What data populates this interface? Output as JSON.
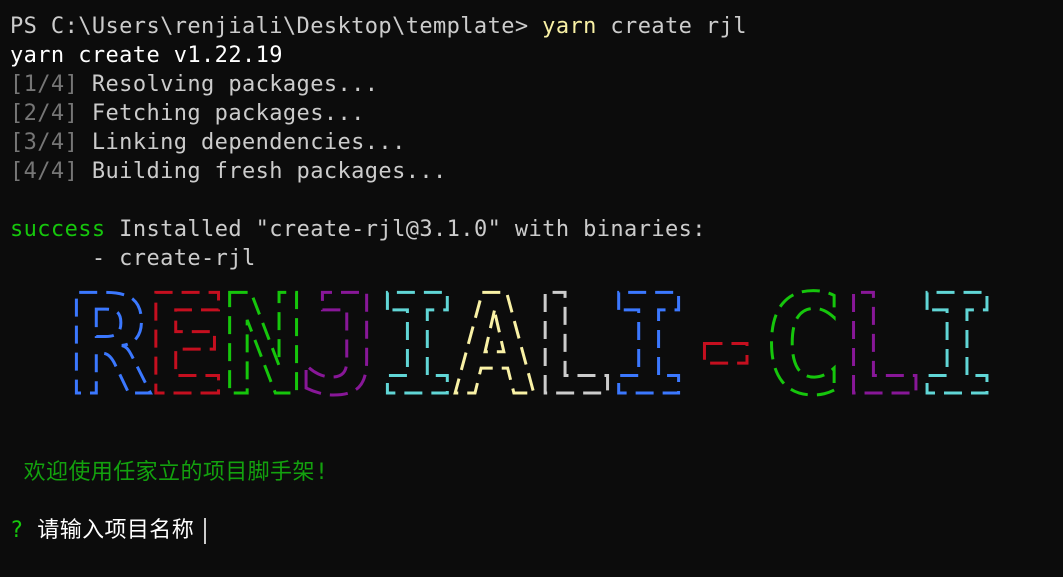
{
  "terminal": {
    "prompt_prefix": "PS C:\\Users\\renjiali\\Desktop\\template> ",
    "command_name": "yarn",
    "command_args": " create rjl",
    "yarn_version_line": "yarn create v1.22.19",
    "steps": [
      {
        "tag": "[1/4]",
        "text": " Resolving packages..."
      },
      {
        "tag": "[2/4]",
        "text": " Fetching packages..."
      },
      {
        "tag": "[3/4]",
        "text": " Linking dependencies..."
      },
      {
        "tag": "[4/4]",
        "text": " Building fresh packages..."
      }
    ],
    "success_word": "success",
    "success_text": " Installed \"create-rjl@3.1.0\" with binaries:",
    "binary_line": "      - create-rjl",
    "banner_text": "RENJIALI-CLI",
    "banner_colors": [
      "#3b78ff",
      "#c50f1f",
      "#16c60c",
      "#881798",
      "#61d6d6",
      "#f9f1a5",
      "#cccccc"
    ],
    "welcome_text": " 欢迎使用任家立的项目脚手架!",
    "question_mark": "?",
    "question_text": " 请输入项目名称"
  }
}
